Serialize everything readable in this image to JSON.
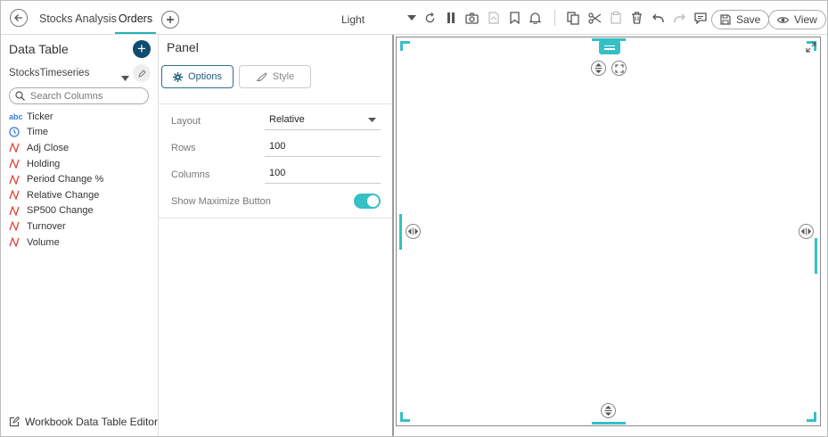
{
  "topbar": {
    "tabs": [
      {
        "label": "Stocks Analysis",
        "active": false
      },
      {
        "label": "Orders",
        "active": true
      }
    ],
    "theme": "Light",
    "save_label": "Save",
    "view_label": "View"
  },
  "left_panel": {
    "title": "Data Table",
    "data_source": "StocksTimeseries",
    "search_placeholder": "Search Columns",
    "columns": [
      {
        "label": "Ticker",
        "type": "text"
      },
      {
        "label": "Time",
        "type": "time"
      },
      {
        "label": "Adj Close",
        "type": "numeric"
      },
      {
        "label": "Holding",
        "type": "numeric"
      },
      {
        "label": "Period Change %",
        "type": "numeric"
      },
      {
        "label": "Relative Change",
        "type": "numeric"
      },
      {
        "label": "SP500 Change",
        "type": "numeric"
      },
      {
        "label": "Turnover",
        "type": "numeric"
      },
      {
        "label": "Volume",
        "type": "numeric"
      }
    ],
    "text_type_badge": "abc",
    "footer_label": "Workbook Data Table Editor"
  },
  "mid_panel": {
    "title": "Panel",
    "options_label": "Options",
    "style_label": "Style",
    "properties": {
      "layout_label": "Layout",
      "layout_value": "Relative",
      "rows_label": "Rows",
      "rows_value": "100",
      "columns_label": "Columns",
      "columns_value": "100",
      "maximize_label": "Show Maximize Button",
      "maximize_enabled": true
    }
  },
  "colors": {
    "accent": "#35c0c6",
    "primary_dark": "#0f4c6e",
    "numeric_icon": "#e0453c",
    "time_icon": "#3a7bd5"
  }
}
